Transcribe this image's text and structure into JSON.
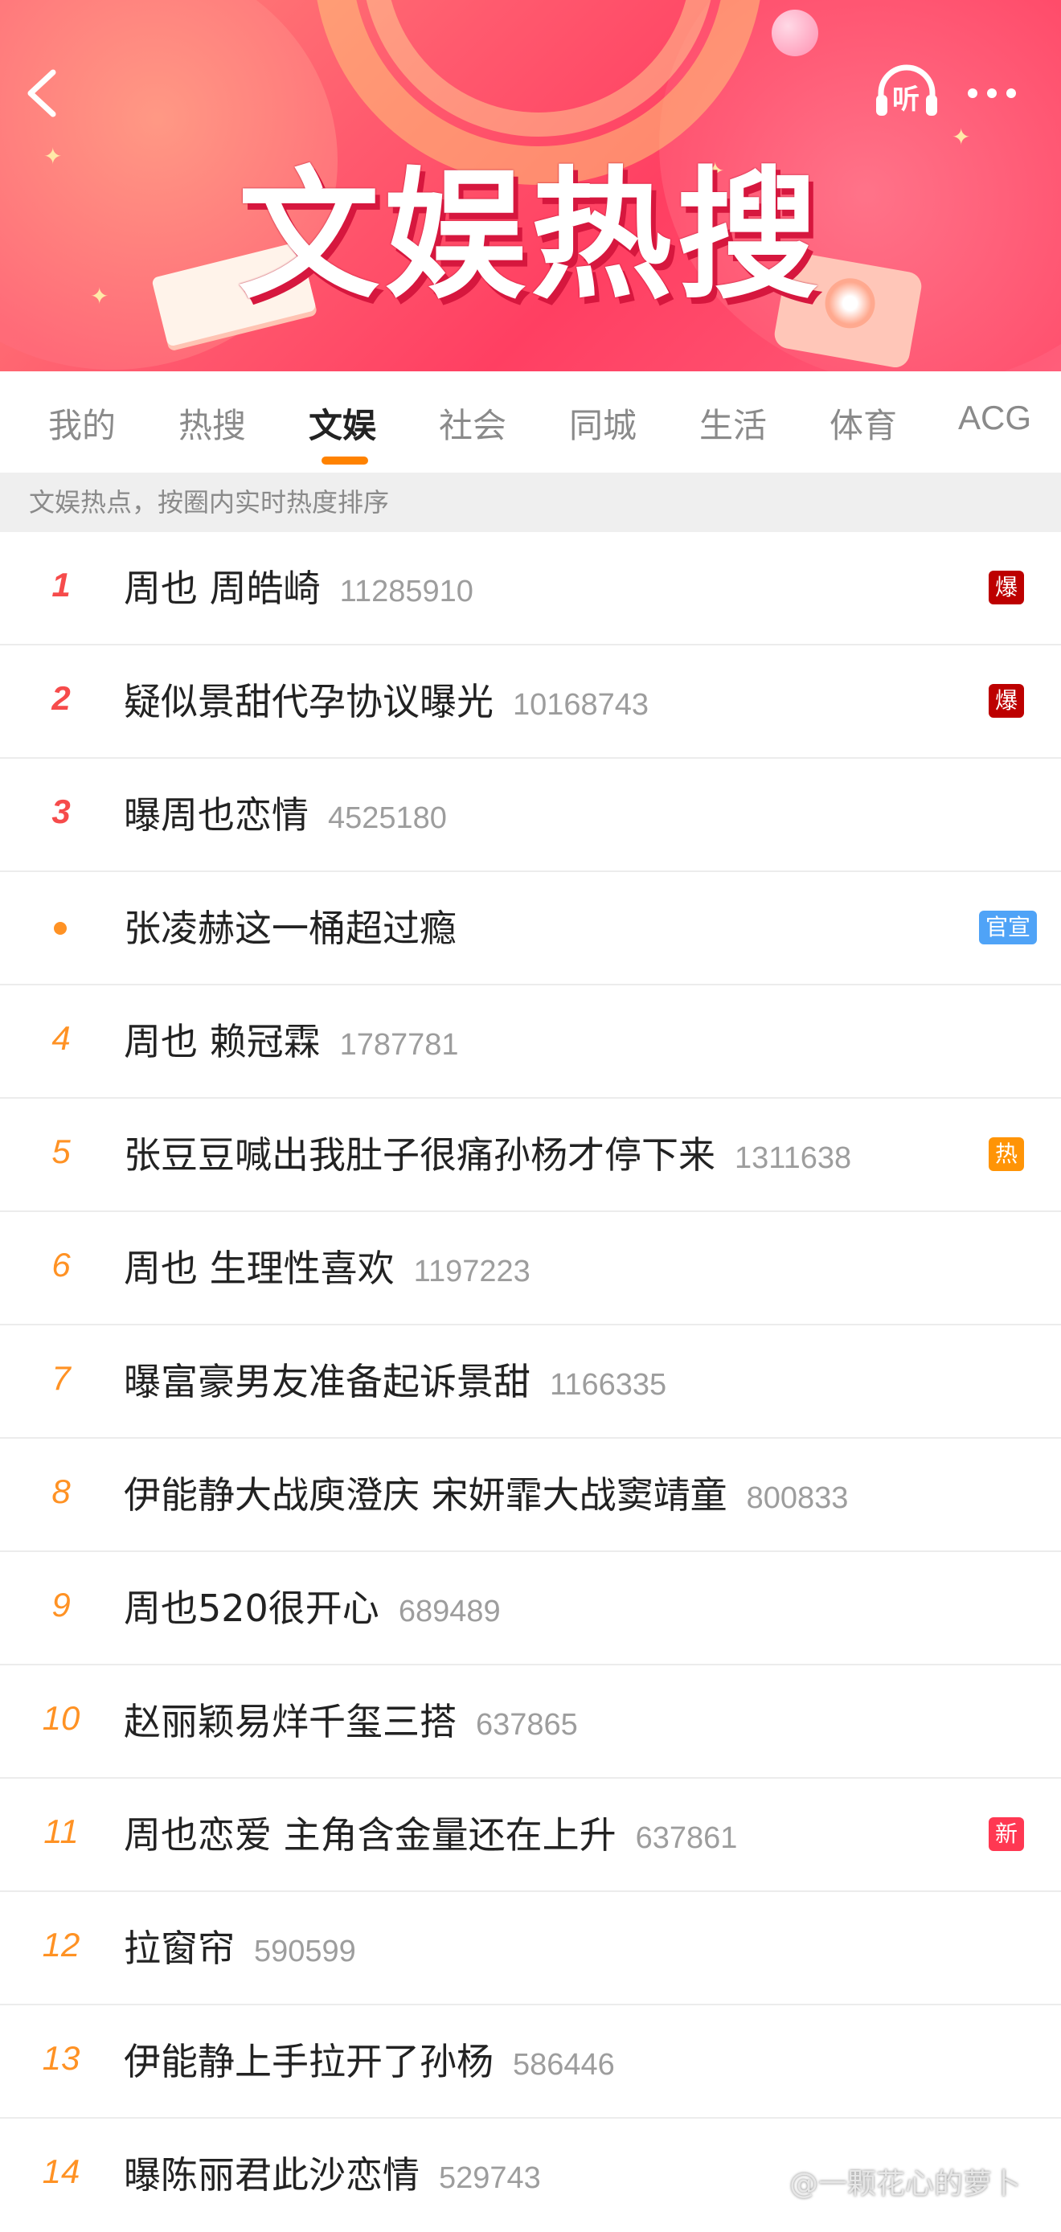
{
  "header": {
    "title": "文娱热搜",
    "listen_label": "听"
  },
  "tabs": [
    {
      "label": "我的"
    },
    {
      "label": "热搜"
    },
    {
      "label": "文娱",
      "active": true
    },
    {
      "label": "社会"
    },
    {
      "label": "同城"
    },
    {
      "label": "生活"
    },
    {
      "label": "体育"
    },
    {
      "label": "ACG"
    }
  ],
  "subheader": "文娱热点，按圈内实时热度排序",
  "items": [
    {
      "rank": "1",
      "title": "周也 周皓崎",
      "count": "11285910",
      "badge": "爆"
    },
    {
      "rank": "2",
      "title": "疑似景甜代孕协议曝光",
      "count": "10168743",
      "badge": "爆"
    },
    {
      "rank": "3",
      "title": "曝周也恋情",
      "count": "4525180",
      "badge": ""
    },
    {
      "rank": "",
      "title": "张凌赫这一桶超过瘾",
      "count": "",
      "badge": "官宣"
    },
    {
      "rank": "4",
      "title": "周也 赖冠霖",
      "count": "1787781",
      "badge": ""
    },
    {
      "rank": "5",
      "title": "张豆豆喊出我肚子很痛孙杨才停下来",
      "count": "1311638",
      "badge": "热"
    },
    {
      "rank": "6",
      "title": "周也 生理性喜欢",
      "count": "1197223",
      "badge": ""
    },
    {
      "rank": "7",
      "title": "曝富豪男友准备起诉景甜",
      "count": "1166335",
      "badge": ""
    },
    {
      "rank": "8",
      "title": "伊能静大战庾澄庆 宋妍霏大战窦靖童",
      "count": "800833",
      "badge": ""
    },
    {
      "rank": "9",
      "title": "周也520很开心",
      "count": "689489",
      "badge": ""
    },
    {
      "rank": "10",
      "title": "赵丽颖易烊千玺三搭",
      "count": "637865",
      "badge": ""
    },
    {
      "rank": "11",
      "title": "周也恋爱 主角含金量还在上升",
      "count": "637861",
      "badge": "新"
    },
    {
      "rank": "12",
      "title": "拉窗帘",
      "count": "590599",
      "badge": ""
    },
    {
      "rank": "13",
      "title": "伊能静上手拉开了孙杨",
      "count": "586446",
      "badge": ""
    },
    {
      "rank": "14",
      "title": "曝陈丽君此沙恋情",
      "count": "529743",
      "badge": ""
    }
  ],
  "watermark": "@一颗花心的萝卜",
  "colors": {
    "accent": "#ff8200",
    "rank_top": "#f64b4b",
    "rank": "#ff9224",
    "badge_bao": "#bd0000",
    "badge_re": "#ff9406",
    "badge_xin": "#ff3852",
    "badge_guanxuan": "#4fa3f7"
  },
  "icons": {
    "back": "chevron-left-icon",
    "listen": "headphones-icon",
    "more": "more-dots-icon"
  }
}
